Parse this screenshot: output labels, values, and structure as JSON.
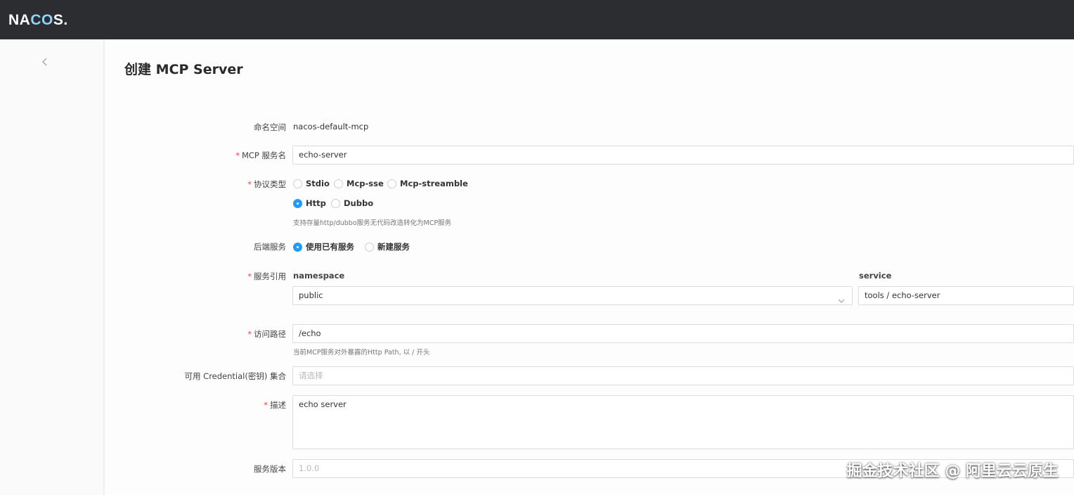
{
  "app": {
    "logo_text_1": "NA",
    "logo_text_2": "CO",
    "logo_text_3": "S.",
    "logo_accent_color": "#8fd4f5",
    "topbar_color": "#2b2d30"
  },
  "sidebar": {
    "back_icon": "chevron-left-icon"
  },
  "page": {
    "title": "创建 MCP Server"
  },
  "form": {
    "namespace": {
      "label": "命名空间",
      "value": "nacos-default-mcp"
    },
    "server_name": {
      "label": "MCP 服务名",
      "required": "*",
      "value": "echo-server"
    },
    "protocol": {
      "label": "协议类型",
      "required": "*",
      "options": [
        "Stdio",
        "Mcp-sse",
        "Mcp-streamble",
        "Http",
        "Dubbo"
      ],
      "selected": "Http",
      "hint": "支持存量http/dubbo服务无代码改造转化为MCP服务"
    },
    "backend": {
      "label": "后端服务",
      "options": [
        "使用已有服务",
        "新建服务"
      ],
      "selected": "使用已有服务"
    },
    "service_ref": {
      "label": "服务引用",
      "required": "*",
      "namespace_label": "namespace",
      "namespace_value": "public",
      "service_label": "service",
      "service_value": "tools / echo-server"
    },
    "path": {
      "label": "访问路径",
      "required": "*",
      "value": "/echo",
      "hint": "当前MCP服务对外暴露的Http Path, 以 / 开头"
    },
    "credential": {
      "label": "可用 Credential(密钥) 集合",
      "placeholder": "请选择"
    },
    "description": {
      "label": "描述",
      "required": "*",
      "value": "echo server"
    },
    "version": {
      "label": "服务版本",
      "placeholder": "1.0.0"
    }
  },
  "watermark": {
    "text": "掘金技术社区 @ 阿里云云原生"
  },
  "colors": {
    "primary": "#209bfa",
    "required": "#e54545"
  }
}
